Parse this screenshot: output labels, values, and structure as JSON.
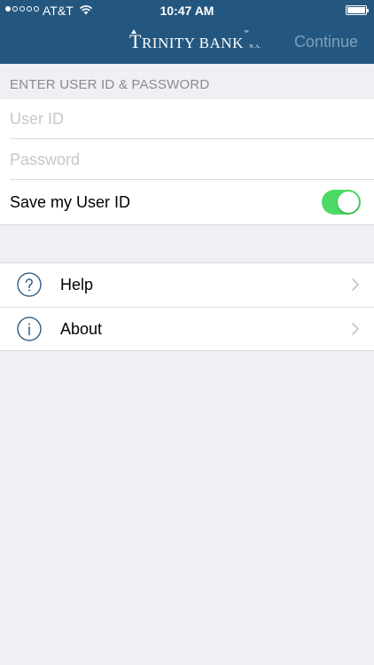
{
  "status_bar": {
    "carrier": "AT&T",
    "time": "10:47 AM",
    "signal_bars_filled": 1,
    "signal_bars_total": 5
  },
  "nav": {
    "logo_first_letter": "T",
    "logo_rest": "RINITY BANK",
    "logo_tm": "™",
    "logo_suffix": "N.A.",
    "continue_label": "Continue"
  },
  "login": {
    "section_header": "ENTER USER ID & PASSWORD",
    "user_id_placeholder": "User ID",
    "password_placeholder": "Password",
    "save_user_id_label": "Save my User ID",
    "save_user_id_enabled": true
  },
  "menu": {
    "items": [
      {
        "label": "Help",
        "icon": "question-circle-icon"
      },
      {
        "label": "About",
        "icon": "info-circle-icon"
      }
    ]
  },
  "colors": {
    "nav_background": "#24577f",
    "continue_disabled": "#7f9fb8",
    "toggle_on": "#4cd964",
    "page_background": "#efeff4",
    "icon_stroke": "#1f4e79"
  }
}
